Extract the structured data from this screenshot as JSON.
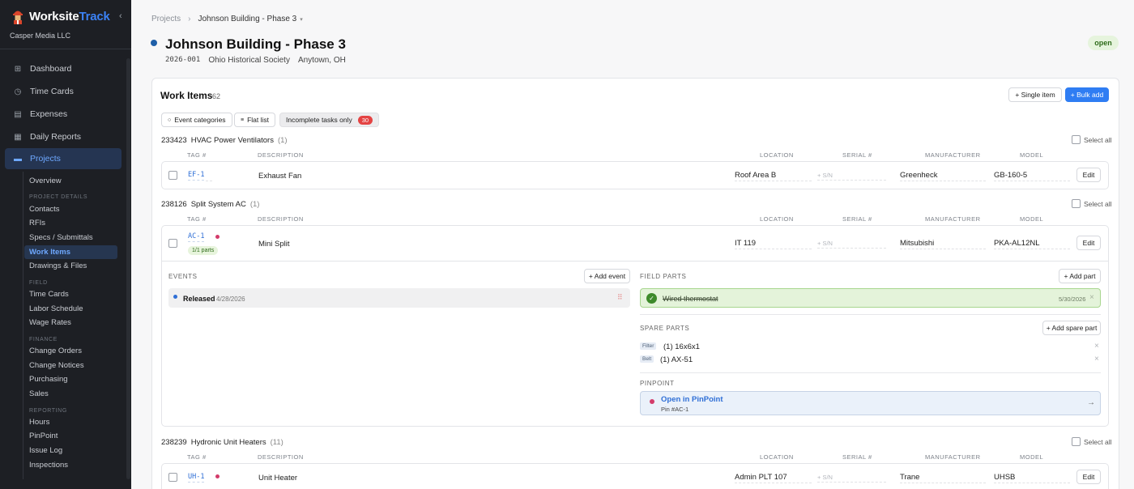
{
  "brand": {
    "name_part1": "Worksite",
    "name_part2": "Track",
    "company": "Casper Media LLC",
    "accent": "#3b82f6"
  },
  "sidebar": {
    "nav": [
      {
        "label": "Dashboard",
        "icon": "grid-icon"
      },
      {
        "label": "Time Cards",
        "icon": "clock-icon"
      },
      {
        "label": "Expenses",
        "icon": "receipt-icon"
      },
      {
        "label": "Daily Reports",
        "icon": "report-icon"
      },
      {
        "label": "Projects",
        "icon": "folder-icon",
        "active": true
      }
    ],
    "overview": "Overview",
    "sections": {
      "project_details": "PROJECT DETAILS",
      "field": "FIELD",
      "finance": "FINANCE",
      "reporting": "REPORTING"
    },
    "project_details": [
      "Contacts",
      "RFIs",
      "Specs / Submittals",
      "Work Items",
      "Drawings & Files"
    ],
    "field": [
      "Time Cards",
      "Labor Schedule",
      "Wage Rates"
    ],
    "finance": [
      "Change Orders",
      "Change Notices",
      "Purchasing",
      "Sales"
    ],
    "reporting": [
      "Hours",
      "PinPoint",
      "Issue Log",
      "Inspections"
    ]
  },
  "breadcrumb": {
    "root": "Projects",
    "separator": "›",
    "current": "Johnson Building - Phase 3"
  },
  "project": {
    "title": "Johnson Building - Phase 3",
    "code": "2026-001",
    "client": "Ohio Historical Society",
    "location": "Anytown, OH",
    "status": "open"
  },
  "work_items": {
    "title": "Work Items",
    "count": "62",
    "single_item": "+ Single item",
    "bulk_add": "+ Bulk add",
    "filters": {
      "event_categories": "Event categories",
      "flat_list": "Flat list",
      "incomplete_only": "Incomplete tasks only",
      "incomplete_count": "30"
    },
    "select_all": "Select all",
    "columns": {
      "tag": "TAG #",
      "description": "DESCRIPTION",
      "location": "LOCATION",
      "serial": "SERIAL #",
      "manufacturer": "MANUFACTURER",
      "model": "MODEL"
    },
    "edit": "Edit",
    "sn_placeholder": "+ S/N",
    "groups": [
      {
        "code": "233423",
        "name": "HVAC Power Ventilators",
        "count": "(1)",
        "item": {
          "tag": "EF-1",
          "description": "Exhaust Fan",
          "location": "Roof Area B",
          "manufacturer": "Greenheck",
          "model": "GB-160-5"
        }
      },
      {
        "code": "238126",
        "name": "Split System AC",
        "count": "(1)",
        "item": {
          "tag": "AC-1",
          "parts": "1/1 parts",
          "description": "Mini Split",
          "location": "IT 119",
          "manufacturer": "Mitsubishi",
          "model": "PKA-AL12NL"
        }
      },
      {
        "code": "238239",
        "name": "Hydronic Unit Heaters",
        "count": "(11)",
        "item": {
          "tag": "UH-1",
          "description": "Unit Heater",
          "location": "Admin PLT 107",
          "manufacturer": "Trane",
          "model": "UHSB"
        }
      }
    ],
    "detail": {
      "events_label": "EVENTS",
      "add_event": "+ Add event",
      "event": {
        "name": "Released",
        "date": "4/28/2026"
      },
      "field_parts_label": "FIELD PARTS",
      "add_part": "+ Add part",
      "field_part": {
        "name": "Wired thermostat",
        "date": "5/30/2026"
      },
      "spare_parts_label": "SPARE PARTS",
      "add_spare": "+ Add spare part",
      "spares": [
        {
          "chip": "Filter",
          "text": "(1) 16x6x1"
        },
        {
          "chip": "Belt",
          "text": "(1) AX-51"
        }
      ],
      "pinpoint_label": "PINPOINT",
      "pinpoint_link": "Open in PinPoint",
      "pinpoint_sub": "Pin #AC-1",
      "arrow": "→"
    }
  }
}
